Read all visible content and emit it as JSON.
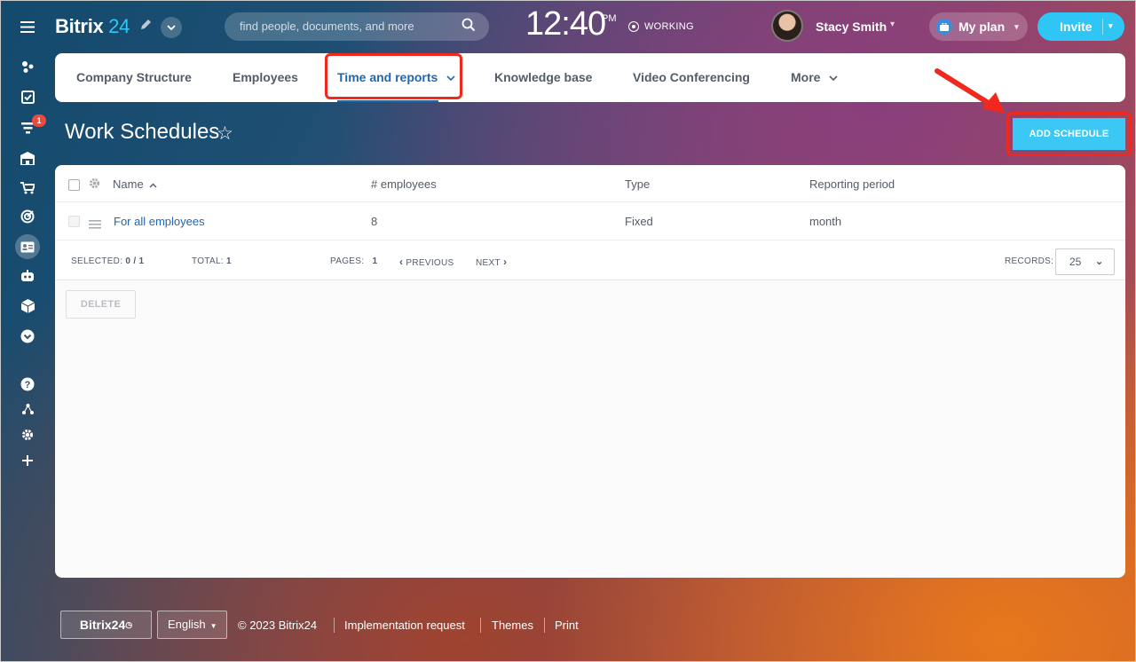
{
  "header": {
    "logo_main": "Bitrix",
    "logo_num": "24",
    "search_placeholder": "find people, documents, and more",
    "clock_time": "12:40",
    "clock_ampm": "PM",
    "status": "WORKING",
    "user_name": "Stacy Smith",
    "plan_label": "My plan",
    "invite_label": "Invite"
  },
  "sidebar": {
    "badge_count": "1",
    "items": [
      {
        "icon": "activity-stream-icon"
      },
      {
        "icon": "tasks-icon"
      },
      {
        "icon": "crm-filter-icon"
      },
      {
        "icon": "company-icon"
      },
      {
        "icon": "shop-cart-icon"
      },
      {
        "icon": "target-icon"
      },
      {
        "icon": "employees-card-icon"
      },
      {
        "icon": "robot-icon"
      },
      {
        "icon": "cube-icon"
      },
      {
        "icon": "more-chevron-icon"
      },
      {
        "icon": "help-icon"
      },
      {
        "icon": "sitemap-icon"
      },
      {
        "icon": "settings-gear-icon"
      },
      {
        "icon": "plus-icon"
      }
    ]
  },
  "nav": {
    "tabs": [
      {
        "label": "Company Structure"
      },
      {
        "label": "Employees"
      },
      {
        "label": "Time and reports"
      },
      {
        "label": "Knowledge base"
      },
      {
        "label": "Video Conferencing"
      },
      {
        "label": "More"
      }
    ]
  },
  "page": {
    "title": "Work Schedules",
    "add_button": "ADD SCHEDULE"
  },
  "grid": {
    "columns": [
      "Name",
      "# employees",
      "Type",
      "Reporting period"
    ],
    "rows": [
      {
        "name": "For all employees",
        "employees": "8",
        "type": "Fixed",
        "period": "month"
      }
    ],
    "footer": {
      "selected_label": "SELECTED:",
      "selected_value": "0 / 1",
      "total_label": "TOTAL:",
      "total_value": "1",
      "pages_label": "PAGES:",
      "pages_value": "1",
      "previous": "PREVIOUS",
      "next": "NEXT",
      "records_label": "RECORDS:",
      "records_value": "25"
    },
    "delete_button": "DELETE"
  },
  "footer": {
    "logo": "Bitrix24",
    "language": "English",
    "copyright": "© 2023 Bitrix24",
    "links": [
      "Implementation request",
      "Themes",
      "Print"
    ]
  },
  "colors": {
    "accent": "#2fc6f6",
    "link": "#2067b0",
    "highlight": "#f0281e",
    "badge": "#f0483c"
  }
}
